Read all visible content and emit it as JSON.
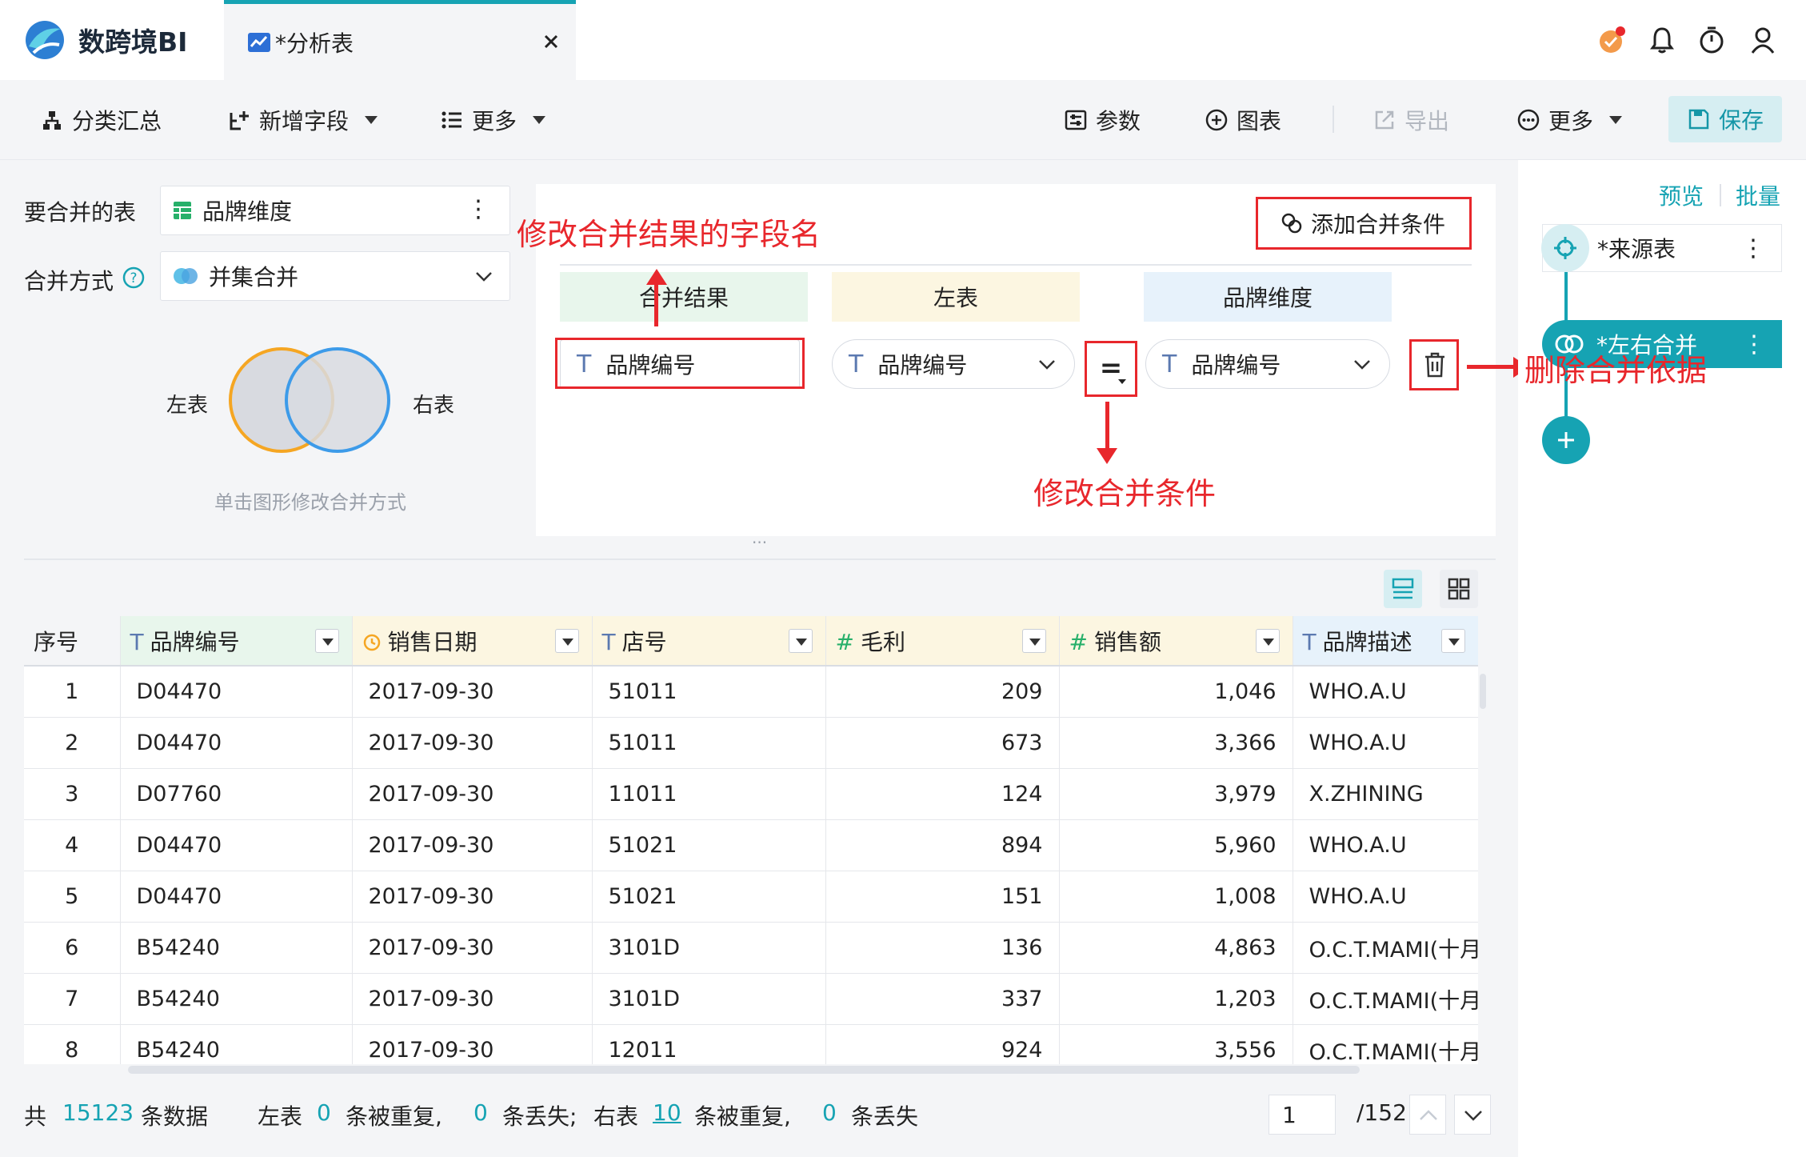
{
  "brand": {
    "name": "数跨境BI"
  },
  "tab": {
    "title": "*分析表"
  },
  "toolbar": {
    "group_summary": "分类汇总",
    "add_field": "新增字段",
    "more_left": "更多",
    "params": "参数",
    "chart": "图表",
    "export": "导出",
    "more_right": "更多",
    "save": "保存"
  },
  "settings": {
    "merge_table_label": "要合并的表",
    "merge_table_value": "品牌维度",
    "merge_mode_label": "合并方式",
    "merge_mode_value": "并集合并",
    "venn_left": "左表",
    "venn_right": "右表",
    "venn_hint": "单击图形修改合并方式"
  },
  "conditions": {
    "add_button": "添加合并条件",
    "head_result": "合并结果",
    "head_left": "左表",
    "head_right": "品牌维度",
    "result_field": "品牌编号",
    "left_field": "品牌编号",
    "operator": "=",
    "right_field": "品牌编号"
  },
  "annotations": {
    "rename_result": "修改合并结果的字段名",
    "change_condition": "修改合并条件",
    "delete_basis": "删除合并依据"
  },
  "flow": {
    "preview": "预览",
    "batch": "批量",
    "node_source": "*来源表",
    "node_merge": "*左右合并"
  },
  "table": {
    "columns": [
      {
        "label": "序号",
        "type": ""
      },
      {
        "label": "品牌编号",
        "type": "T"
      },
      {
        "label": "销售日期",
        "type": "date"
      },
      {
        "label": "店号",
        "type": "T"
      },
      {
        "label": "毛利",
        "type": "#"
      },
      {
        "label": "销售额",
        "type": "#"
      },
      {
        "label": "品牌描述",
        "type": "T"
      }
    ],
    "rows": [
      [
        "1",
        "D04470",
        "2017-09-30",
        "51011",
        "209",
        "1,046",
        "WHO.A.U"
      ],
      [
        "2",
        "D04470",
        "2017-09-30",
        "51011",
        "673",
        "3,366",
        "WHO.A.U"
      ],
      [
        "3",
        "D07760",
        "2017-09-30",
        "11011",
        "124",
        "3,979",
        "X.ZHINING"
      ],
      [
        "4",
        "D04470",
        "2017-09-30",
        "51021",
        "894",
        "5,960",
        "WHO.A.U"
      ],
      [
        "5",
        "D04470",
        "2017-09-30",
        "51021",
        "151",
        "1,008",
        "WHO.A.U"
      ],
      [
        "6",
        "B54240",
        "2017-09-30",
        "3101D",
        "136",
        "4,863",
        "O.C.T.MAMI(十月"
      ],
      [
        "7",
        "B54240",
        "2017-09-30",
        "3101D",
        "337",
        "1,203",
        "O.C.T.MAMI(十月"
      ],
      [
        "8",
        "B54240",
        "2017-09-30",
        "12011",
        "924",
        "3,556",
        "O.C.T.MAMI(十月"
      ]
    ]
  },
  "footer": {
    "total_prefix": "共",
    "total_count": "15123",
    "total_suffix": "条数据",
    "left_label": "左表",
    "left_dup": "0",
    "dup_text": "条被重复,",
    "left_lost": "0",
    "lost_text_semicolon": "条丢失;",
    "right_label": "右表",
    "right_dup": "10",
    "dup_text_2": "条被重复,",
    "right_lost": "0",
    "lost_text": "条丢失",
    "page_current": "1",
    "page_total": "/152"
  },
  "colors": {
    "accent": "#16a3b3",
    "annotation": "#e8272c",
    "venn_left": "#f5a623",
    "venn_right": "#3d9be9"
  }
}
